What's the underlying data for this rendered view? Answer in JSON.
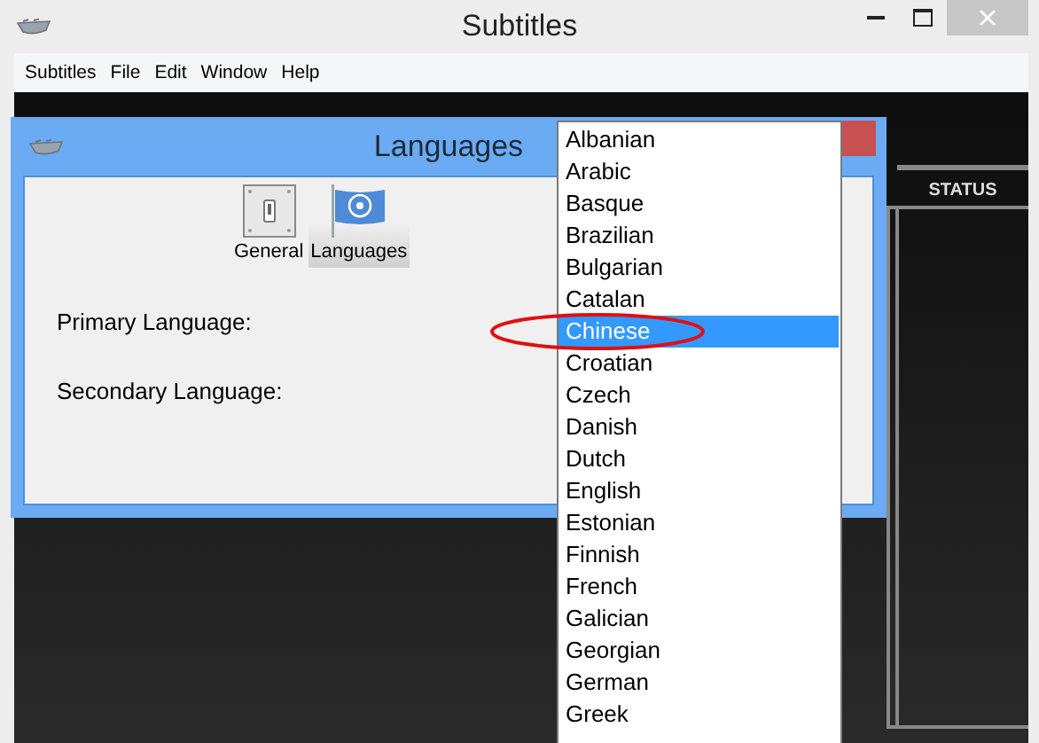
{
  "window": {
    "title": "Subtitles"
  },
  "menu_bar": [
    "Subtitles",
    "File",
    "Edit",
    "Window",
    "Help"
  ],
  "table": {
    "columns": [
      "STATUS"
    ]
  },
  "dialog": {
    "title": "Languages",
    "toolbar": [
      {
        "label": "General",
        "kind": "switch",
        "selected": false
      },
      {
        "label": "Languages",
        "kind": "flag",
        "selected": true
      }
    ],
    "fields": [
      {
        "label": "Primary Language:"
      },
      {
        "label": "Secondary Language:"
      }
    ]
  },
  "dropdown": {
    "items": [
      {
        "label": "Albanian",
        "selected": false,
        "circled": false
      },
      {
        "label": "Arabic",
        "selected": false,
        "circled": false
      },
      {
        "label": "Basque",
        "selected": false,
        "circled": false
      },
      {
        "label": "Brazilian",
        "selected": false,
        "circled": false
      },
      {
        "label": "Bulgarian",
        "selected": false,
        "circled": false
      },
      {
        "label": "Catalan",
        "selected": false,
        "circled": false
      },
      {
        "label": "Chinese",
        "selected": true,
        "circled": true
      },
      {
        "label": "Croatian",
        "selected": false,
        "circled": false
      },
      {
        "label": "Czech",
        "selected": false,
        "circled": false
      },
      {
        "label": "Danish",
        "selected": false,
        "circled": false
      },
      {
        "label": "Dutch",
        "selected": false,
        "circled": false
      },
      {
        "label": "English",
        "selected": false,
        "circled": false
      },
      {
        "label": "Estonian",
        "selected": false,
        "circled": false
      },
      {
        "label": "Finnish",
        "selected": false,
        "circled": false
      },
      {
        "label": "French",
        "selected": false,
        "circled": false
      },
      {
        "label": "Galician",
        "selected": false,
        "circled": false
      },
      {
        "label": "Georgian",
        "selected": false,
        "circled": false
      },
      {
        "label": "German",
        "selected": false,
        "circled": false
      },
      {
        "label": "Greek",
        "selected": false,
        "circled": false
      }
    ]
  }
}
